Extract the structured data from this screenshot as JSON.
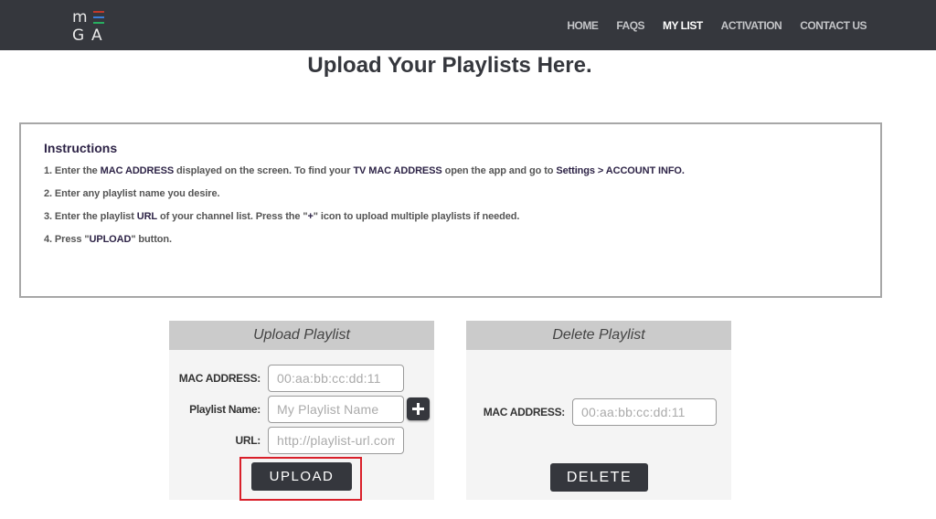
{
  "nav": {
    "logo_text": "MEGA",
    "items": [
      {
        "label": "HOME",
        "active": false
      },
      {
        "label": "FAQS",
        "active": false
      },
      {
        "label": "MY LIST",
        "active": true
      },
      {
        "label": "ACTIVATION",
        "active": false
      },
      {
        "label": "CONTACT US",
        "active": false
      }
    ]
  },
  "page_title": "Upload Your Playlists Here.",
  "instructions": {
    "title": "Instructions",
    "steps": [
      {
        "parts": [
          [
            "1. Enter the ",
            false
          ],
          [
            "MAC ADDRESS",
            true
          ],
          [
            " displayed on the screen. To find your ",
            false
          ],
          [
            "TV MAC ADDRESS",
            true
          ],
          [
            " open the app and go to ",
            false
          ],
          [
            "Settings > ACCOUNT INFO.",
            true
          ]
        ]
      },
      {
        "parts": [
          [
            "2. Enter any playlist name you desire.",
            false
          ]
        ]
      },
      {
        "parts": [
          [
            "3. Enter the playlist ",
            false
          ],
          [
            "URL",
            true
          ],
          [
            " of your channel list. Press the \"",
            false
          ],
          [
            "+",
            true
          ],
          [
            "\" icon to upload multiple playlists if needed.",
            false
          ]
        ]
      },
      {
        "parts": [
          [
            "4. Press \"",
            false
          ],
          [
            "UPLOAD",
            true
          ],
          [
            "\" button.",
            false
          ]
        ]
      }
    ]
  },
  "upload_panel": {
    "title": "Upload Playlist",
    "mac_label": "MAC ADDRESS:",
    "mac_placeholder": "00:aa:bb:cc:dd:11",
    "name_label": "Playlist Name:",
    "name_placeholder": "My Playlist Name",
    "url_label": "URL:",
    "url_placeholder": "http://playlist-url.com",
    "add_icon": "plus-icon",
    "upload_button": "UPLOAD"
  },
  "delete_panel": {
    "title": "Delete Playlist",
    "mac_label": "MAC ADDRESS:",
    "mac_placeholder": "00:aa:bb:cc:dd:11",
    "delete_button": "DELETE"
  },
  "colors": {
    "navbar": "#35373d",
    "accent_text": "#2e2447",
    "highlight": "#d9202a",
    "panel_header": "#cbcbcb"
  }
}
